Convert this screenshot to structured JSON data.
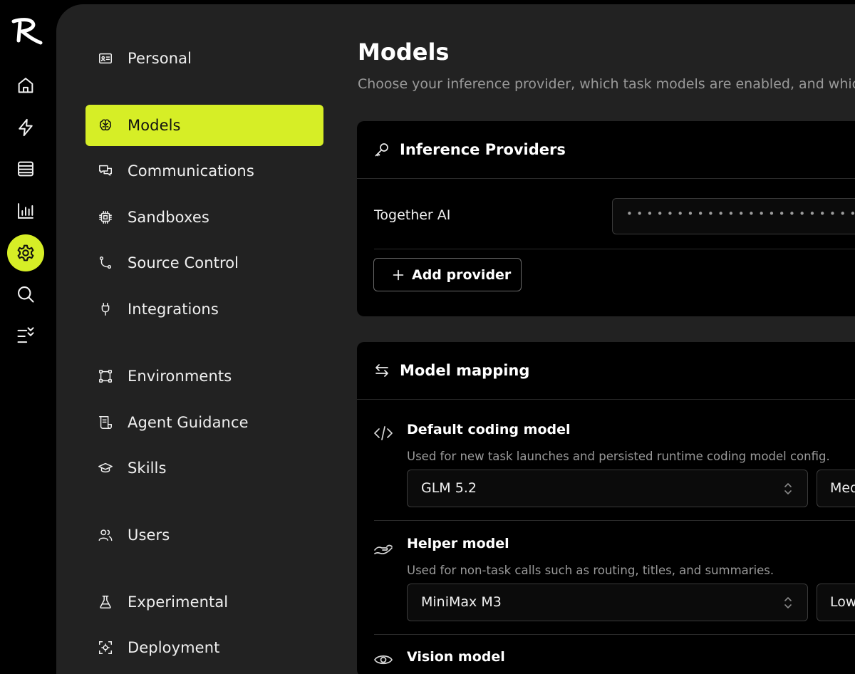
{
  "rail": {
    "items": [
      {
        "name": "home",
        "icon": "home-icon"
      },
      {
        "name": "activity",
        "icon": "bolt-icon"
      },
      {
        "name": "list",
        "icon": "table-icon"
      },
      {
        "name": "analytics",
        "icon": "bar-chart-icon"
      },
      {
        "name": "settings",
        "icon": "gear-icon",
        "active": true
      },
      {
        "name": "search",
        "icon": "search-icon"
      },
      {
        "name": "tasks",
        "icon": "checklist-icon"
      }
    ]
  },
  "nav": {
    "items": [
      {
        "label": "Personal",
        "icon": "id-card-icon"
      },
      {
        "label": "Models",
        "icon": "brain-icon",
        "active": true
      },
      {
        "label": "Communications",
        "icon": "chat-bubbles-icon"
      },
      {
        "label": "Sandboxes",
        "icon": "chip-icon"
      },
      {
        "label": "Source Control",
        "icon": "git-branch-icon"
      },
      {
        "label": "Integrations",
        "icon": "plug-icon"
      },
      {
        "label": "Environments",
        "icon": "frame-icon"
      },
      {
        "label": "Agent Guidance",
        "icon": "scroll-icon"
      },
      {
        "label": "Skills",
        "icon": "graduation-cap-icon"
      },
      {
        "label": "Users",
        "icon": "users-icon"
      },
      {
        "label": "Experimental",
        "icon": "flask-icon"
      },
      {
        "label": "Deployment",
        "icon": "deployment-icon"
      }
    ]
  },
  "page": {
    "title": "Models",
    "description": "Choose your inference provider, which task models are enabled, and whic"
  },
  "inference": {
    "title": "Inference Providers",
    "provider_name": "Together AI",
    "api_key_mask": "••••••••••••••••••••••••",
    "add_label": "Add provider"
  },
  "mapping": {
    "title": "Model mapping",
    "rows": [
      {
        "title": "Default coding model",
        "description": "Used for new task launches and persisted runtime coding model config.",
        "model": "GLM 5.2",
        "effort": "Med",
        "icon": "code-icon"
      },
      {
        "title": "Helper model",
        "description": "Used for non-task calls such as routing, titles, and summaries.",
        "model": "MiniMax M3",
        "effort": "Low",
        "icon": "helper-hand-icon"
      },
      {
        "title": "Vision model",
        "icon": "eye-icon"
      }
    ]
  },
  "colors": {
    "accent": "#d6ee26",
    "background": "#000000",
    "panel": "#222222",
    "card": "#000000",
    "muted_text": "#9a9a9a"
  }
}
